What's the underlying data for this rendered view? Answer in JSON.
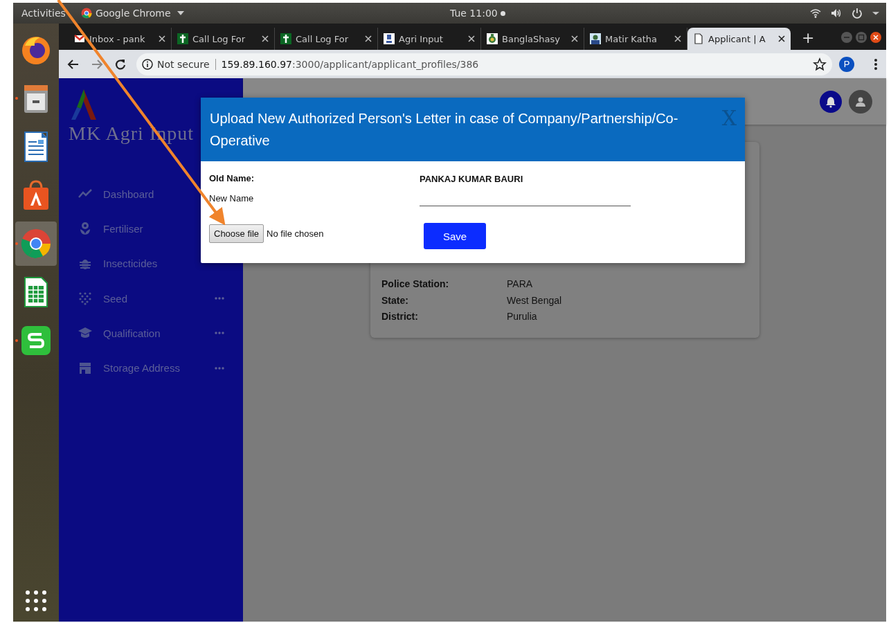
{
  "top_bar": {
    "activities": "Activities",
    "app_name": "Google Chrome",
    "clock": "Tue 11:00"
  },
  "dock": [
    {
      "kind": "firefox",
      "running": false,
      "active": false
    },
    {
      "kind": "files",
      "running": true,
      "active": false
    },
    {
      "kind": "writer",
      "running": false,
      "active": false
    },
    {
      "kind": "software",
      "running": false,
      "active": false
    },
    {
      "kind": "chrome",
      "running": true,
      "active": true
    },
    {
      "kind": "calc",
      "running": false,
      "active": false
    },
    {
      "kind": "slides",
      "running": true,
      "active": false
    }
  ],
  "tabs": [
    {
      "title": "Inbox - pank",
      "kind": "mail",
      "selected": false
    },
    {
      "title": "Call Log For",
      "kind": "cross",
      "selected": false
    },
    {
      "title": "Call Log For",
      "kind": "cross",
      "selected": false
    },
    {
      "title": "Agri Input",
      "kind": "emblem",
      "selected": false
    },
    {
      "title": "BanglaShasy",
      "kind": "seal",
      "selected": false
    },
    {
      "title": "Matir Katha",
      "kind": "portrait",
      "selected": false
    },
    {
      "title": "Applicant | A",
      "kind": "page",
      "selected": true
    }
  ],
  "new_tab": "+",
  "address_bar": {
    "security": "Not secure",
    "url": "**159.89.160.97**:3000/applicant/applicant_profiles/386"
  },
  "profile": {
    "initial": "P"
  },
  "sidebar": {
    "brand": "MK Agri Input",
    "items": [
      {
        "label": "Dashboard",
        "kind": "chart",
        "more": false
      },
      {
        "label": "Fertiliser",
        "kind": "flower",
        "more": false
      },
      {
        "label": "Insecticides",
        "kind": "bug",
        "more": false
      },
      {
        "label": "Seed",
        "kind": "dots",
        "more": true
      },
      {
        "label": "Qualification",
        "kind": "cap",
        "more": true
      },
      {
        "label": "Storage Address",
        "kind": "store",
        "more": true
      }
    ]
  },
  "profile_card": {
    "rows": [
      {
        "label": "Police Station:",
        "value": "PARA"
      },
      {
        "label": "State:",
        "value": "West Bengal"
      },
      {
        "label": "District:",
        "value": "Purulia"
      }
    ]
  },
  "modal": {
    "title": "Upload New Authorized Person's Letter in case of Company/Partnership/Co-Operative",
    "close": "X",
    "fields": [
      {
        "label": "Old Name:",
        "kind": "text",
        "value": "PANKAJ KUMAR BAURI"
      },
      {
        "label": "New Name",
        "kind": "input"
      }
    ],
    "file_button": "Choose file",
    "file_status": "No file chosen",
    "save": "Save"
  }
}
